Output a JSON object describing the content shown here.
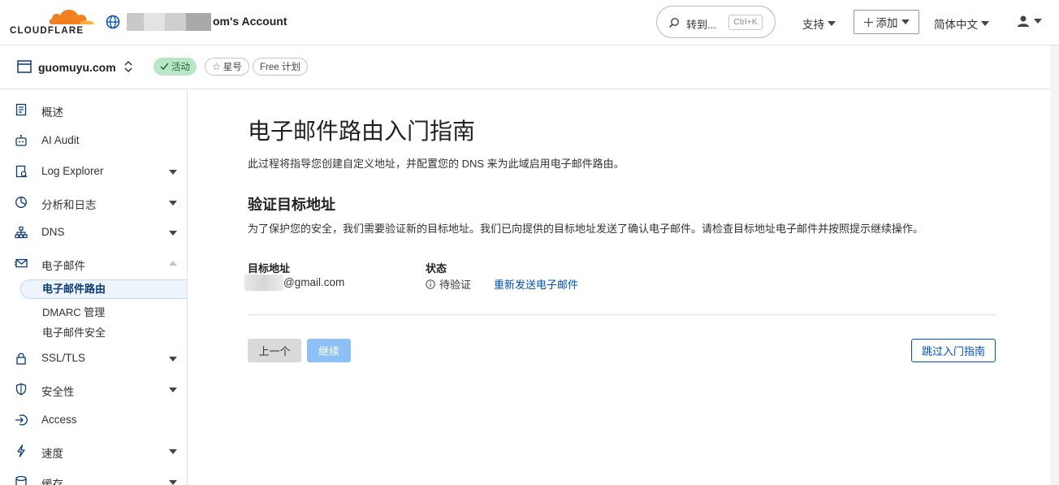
{
  "brand": {
    "logo_text": "CLOUDFLARE",
    "orange": "#f38020"
  },
  "account": {
    "name_suffix": "om's Account"
  },
  "search": {
    "label": "转到...",
    "shortcut": "Ctrl+K"
  },
  "topnav": {
    "support": "支持",
    "add": "添加",
    "language": "简体中文"
  },
  "zone": {
    "name": "guomuyu.com",
    "status": "活动",
    "star": "星号",
    "plan": "Free 计划"
  },
  "sidebar": {
    "items": [
      {
        "label": "概述",
        "icon": "document-icon"
      },
      {
        "label": "AI Audit",
        "icon": "bot-icon"
      },
      {
        "label": "Log Explorer",
        "icon": "log-icon"
      },
      {
        "label": "分析和日志",
        "icon": "chart-pie-icon"
      },
      {
        "label": "DNS",
        "icon": "network-icon"
      },
      {
        "label": "电子邮件",
        "icon": "mail-icon"
      },
      {
        "label": "SSL/TLS",
        "icon": "lock-icon"
      },
      {
        "label": "安全性",
        "icon": "shield-icon"
      },
      {
        "label": "Access",
        "icon": "access-icon"
      },
      {
        "label": "速度",
        "icon": "lightning-icon"
      },
      {
        "label": "缓存",
        "icon": "cache-icon"
      }
    ],
    "email_sub": [
      "电子邮件路由",
      "DMARC 管理",
      "电子邮件安全"
    ]
  },
  "main": {
    "title": "电子邮件路由入门指南",
    "lead": "此过程将指导您创建自定义地址，并配置您的 DNS 来为此域启用电子邮件路由。",
    "section_title": "验证目标地址",
    "section_desc": "为了保护您的安全，我们需要验证新的目标地址。我们已向提供的目标地址发送了确认电子邮件。请检查目标地址电子邮件并按照提示继续操作。",
    "col_address": "目标地址",
    "col_status": "状态",
    "email_domain": "@gmail.com",
    "status_value": "待验证",
    "resend_link": "重新发送电子邮件",
    "btn_prev": "上一个",
    "btn_next": "继续",
    "btn_skip": "跳过入门指南"
  }
}
